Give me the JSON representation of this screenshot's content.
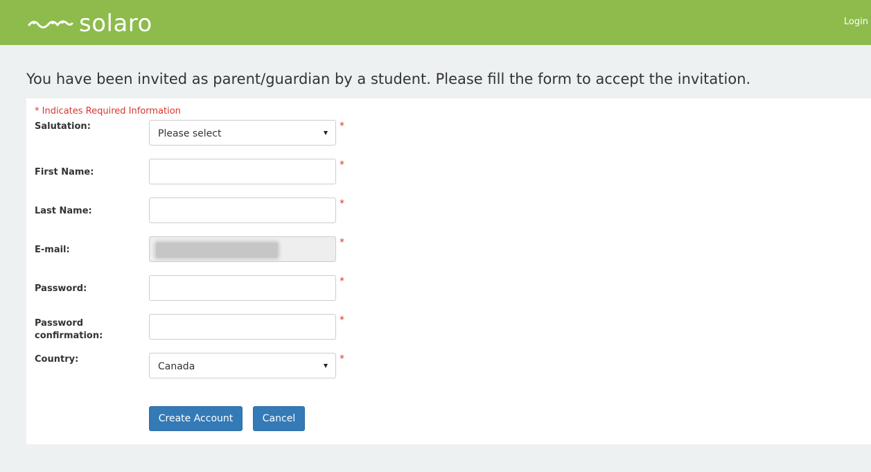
{
  "header": {
    "brand": "solaro",
    "login_label": "Login",
    "brand_color": "#8dbb4c"
  },
  "page": {
    "heading": "You have been invited as parent/guardian by a student. Please fill the form to accept the invitation.",
    "required_note": "* Indicates Required Information",
    "required_marker": "*"
  },
  "form": {
    "salutation": {
      "label": "Salutation:",
      "value": "Please select"
    },
    "first_name": {
      "label": "First Name:",
      "value": ""
    },
    "last_name": {
      "label": "Last Name:",
      "value": ""
    },
    "email": {
      "label": "E-mail:",
      "value": ""
    },
    "password": {
      "label": "Password:",
      "value": ""
    },
    "password_confirmation": {
      "label": "Password confirmation:",
      "value": ""
    },
    "country": {
      "label": "Country:",
      "value": "Canada"
    }
  },
  "actions": {
    "create_label": "Create Account",
    "cancel_label": "Cancel",
    "button_color": "#337ab7"
  },
  "icons": {
    "logo": "solaro-wave-logo-icon",
    "dropdown": "caret-down-icon"
  }
}
